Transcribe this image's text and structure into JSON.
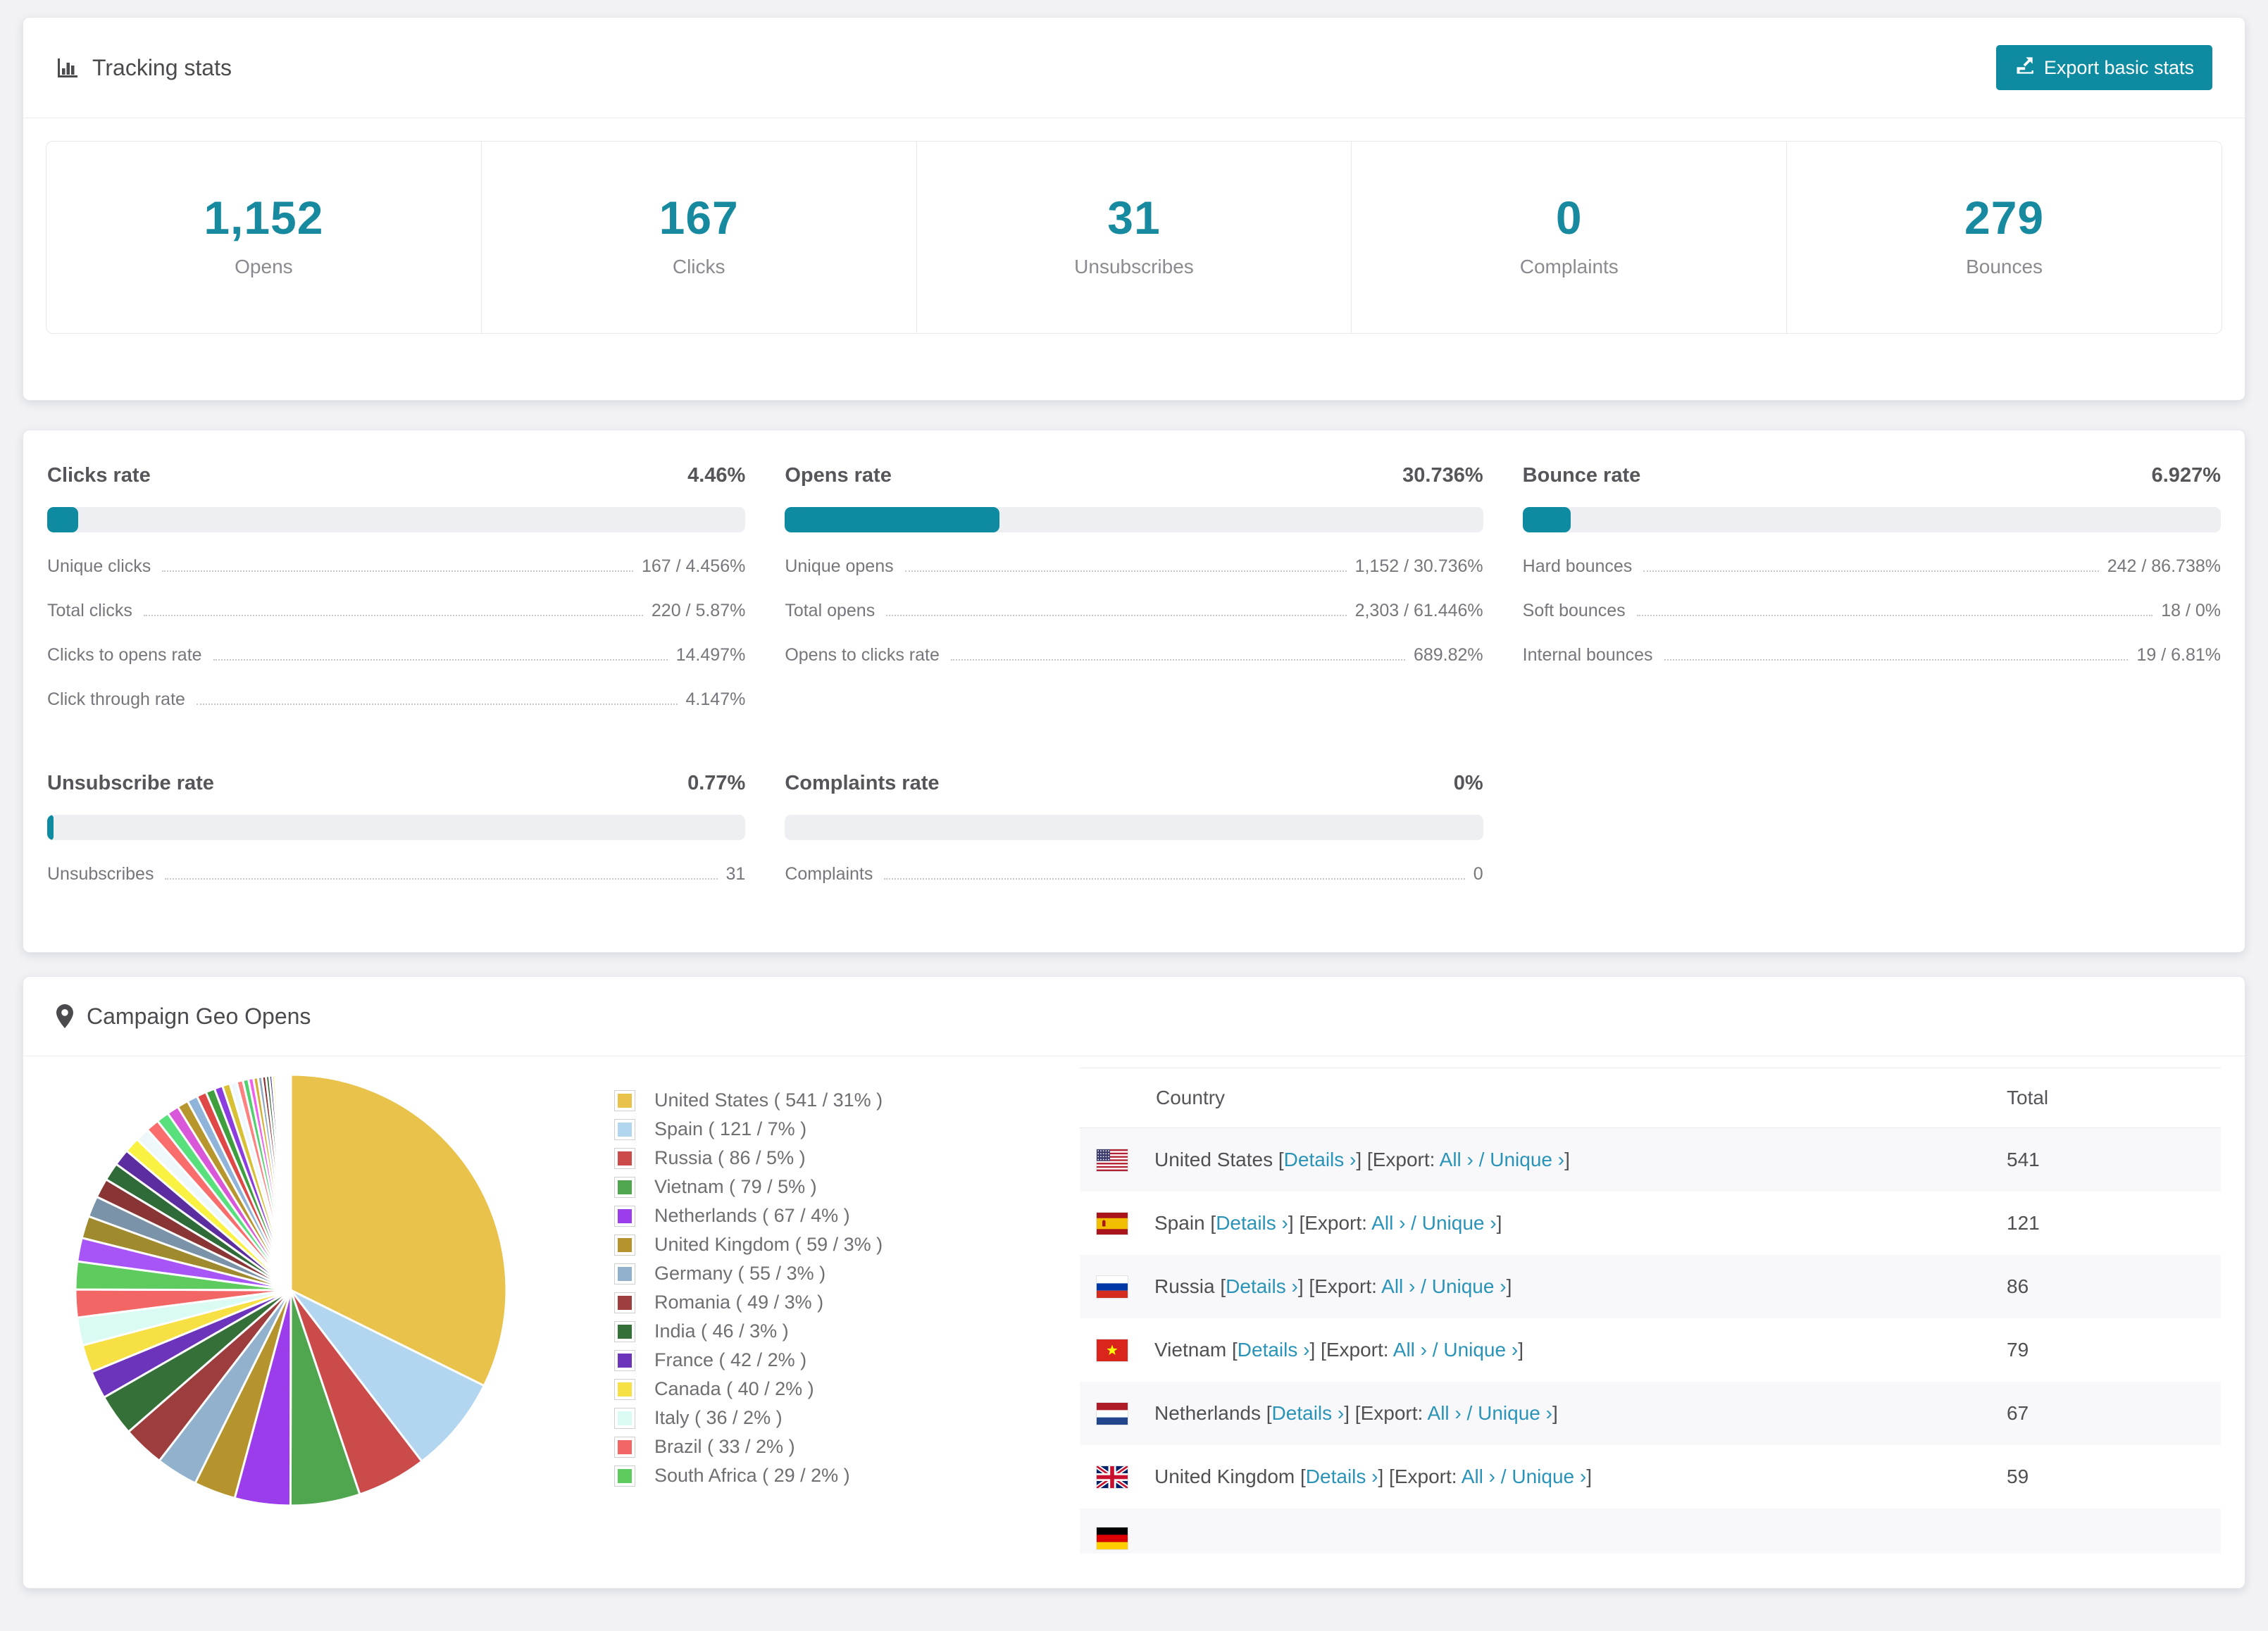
{
  "accent": "#0e8ba1",
  "link_color": "#2a93b8",
  "tracking": {
    "title": "Tracking stats",
    "export_button": "Export basic stats",
    "stats": [
      {
        "value": "1,152",
        "label": "Opens"
      },
      {
        "value": "167",
        "label": "Clicks"
      },
      {
        "value": "31",
        "label": "Unsubscribes"
      },
      {
        "value": "0",
        "label": "Complaints"
      },
      {
        "value": "279",
        "label": "Bounces"
      }
    ]
  },
  "rates": {
    "blocks": [
      {
        "name": "Clicks rate",
        "value": "4.46%",
        "percent": 4.46,
        "rows": [
          {
            "label": "Unique clicks",
            "value": "167 / 4.456%"
          },
          {
            "label": "Total clicks",
            "value": "220 / 5.87%"
          },
          {
            "label": "Clicks to opens rate",
            "value": "14.497%"
          },
          {
            "label": "Click through rate",
            "value": "4.147%"
          }
        ]
      },
      {
        "name": "Opens rate",
        "value": "30.736%",
        "percent": 30.736,
        "rows": [
          {
            "label": "Unique opens",
            "value": "1,152 / 30.736%"
          },
          {
            "label": "Total opens",
            "value": "2,303 / 61.446%"
          },
          {
            "label": "Opens to clicks rate",
            "value": "689.82%"
          }
        ]
      },
      {
        "name": "Bounce rate",
        "value": "6.927%",
        "percent": 6.927,
        "rows": [
          {
            "label": "Hard bounces",
            "value": "242 / 86.738%"
          },
          {
            "label": "Soft bounces",
            "value": "18 / 0%"
          },
          {
            "label": "Internal bounces",
            "value": "19 / 6.81%"
          }
        ]
      },
      {
        "name": "Unsubscribe rate",
        "value": "0.77%",
        "percent": 0.77,
        "rows": [
          {
            "label": "Unsubscribes",
            "value": "31"
          }
        ]
      },
      {
        "name": "Complaints rate",
        "value": "0%",
        "percent": 0,
        "rows": [
          {
            "label": "Complaints",
            "value": "0"
          }
        ]
      }
    ]
  },
  "geo": {
    "title": "Campaign Geo Opens",
    "table": {
      "headers": [
        "Country",
        "Total"
      ],
      "link_tokens": {
        "open_bracket": " [",
        "details": "Details ›",
        "export_mid": "] [Export: ",
        "all": "All ›",
        "slash": " / ",
        "unique": "Unique ›",
        "close_bracket": "]"
      },
      "rows": [
        {
          "country": "United States",
          "flag": "us",
          "total": "541"
        },
        {
          "country": "Spain",
          "flag": "es",
          "total": "121"
        },
        {
          "country": "Russia",
          "flag": "ru",
          "total": "86"
        },
        {
          "country": "Vietnam",
          "flag": "vn",
          "total": "79"
        },
        {
          "country": "Netherlands",
          "flag": "nl",
          "total": "67"
        },
        {
          "country": "United Kingdom",
          "flag": "gb",
          "total": "59"
        }
      ],
      "partial_row": {
        "flag": "de"
      }
    }
  },
  "chart_data": {
    "type": "pie",
    "title": "Campaign Geo Opens",
    "legend_position": "right",
    "start_angle_deg": -90,
    "direction": "clockwise",
    "slices": [
      {
        "label": "United States",
        "count": 541,
        "pct": 31,
        "color": "#e8c24a",
        "legend": "United States ( 541 / 31% )"
      },
      {
        "label": "Spain",
        "count": 121,
        "pct": 7,
        "color": "#b2d5f0",
        "legend": "Spain ( 121 / 7% )"
      },
      {
        "label": "Russia",
        "count": 86,
        "pct": 5,
        "color": "#cb4a4a",
        "legend": "Russia ( 86 / 5% )"
      },
      {
        "label": "Vietnam",
        "count": 79,
        "pct": 5,
        "color": "#4fa64f",
        "legend": "Vietnam ( 79 / 5% )"
      },
      {
        "label": "Netherlands",
        "count": 67,
        "pct": 4,
        "color": "#9b3deb",
        "legend": "Netherlands ( 67 / 4% )"
      },
      {
        "label": "United Kingdom",
        "count": 59,
        "pct": 3,
        "color": "#b5932d",
        "legend": "United Kingdom ( 59 / 3% )"
      },
      {
        "label": "Germany",
        "count": 55,
        "pct": 3,
        "color": "#92b1cc",
        "legend": "Germany ( 55 / 3% )"
      },
      {
        "label": "Romania",
        "count": 49,
        "pct": 3,
        "color": "#9e3d3d",
        "legend": "Romania ( 49 / 3% )"
      },
      {
        "label": "India",
        "count": 46,
        "pct": 3,
        "color": "#357038",
        "legend": "India ( 46 / 3% )"
      },
      {
        "label": "France",
        "count": 42,
        "pct": 2,
        "color": "#6c33bb",
        "legend": "France ( 42 / 2% )"
      },
      {
        "label": "Canada",
        "count": 40,
        "pct": 2,
        "color": "#f6e044",
        "legend": "Canada ( 40 / 2% )"
      },
      {
        "label": "Italy",
        "count": 36,
        "pct": 2,
        "color": "#d9fbf3",
        "legend": "Italy ( 36 / 2% )"
      },
      {
        "label": "Brazil",
        "count": 33,
        "pct": 2,
        "color": "#f26666",
        "legend": "Brazil ( 33 / 2% )"
      },
      {
        "label": "South Africa",
        "count": 29,
        "pct": 2,
        "color": "#5ecb5e",
        "legend": "South Africa ( 29 / 2% )"
      }
    ],
    "others_note": "remaining small unlabeled countries",
    "others_pct": [
      1.7,
      1.6,
      1.5,
      1.4,
      1.3,
      1.2,
      1.1,
      1.0,
      0.95,
      0.9,
      0.85,
      0.8,
      0.75,
      0.7,
      0.65,
      0.6,
      0.55,
      0.5,
      0.45,
      0.4,
      0.36,
      0.33,
      0.3,
      0.27,
      0.24,
      0.21,
      0.19,
      0.17,
      0.15,
      0.13,
      0.11,
      0.1,
      0.09,
      0.08,
      0.07,
      0.06,
      0.05,
      0.05,
      0.04,
      0.04
    ],
    "others_colors": [
      "#a855f7",
      "#a08a2e",
      "#7b93a8",
      "#8a3535",
      "#2f6b38",
      "#5b2d9e",
      "#f9f242",
      "#eef8fb",
      "#fa6d6d",
      "#58e07d",
      "#d957d9",
      "#b8962e",
      "#8fb3d9",
      "#e04848",
      "#3f9f3f",
      "#8c3de0",
      "#d8c035",
      "#f0f8ff",
      "#ff8080",
      "#52d070",
      "#f060f0",
      "#d4af37",
      "#90aac0",
      "#8a3030",
      "#2a5f30",
      "#3a2a8a",
      "#f0ea50",
      "#e8f8ff",
      "#ff9090",
      "#60d080",
      "#e070e0",
      "#c8a838",
      "#98b8d0",
      "#c04040",
      "#50a850",
      "#9850e8",
      "#e8d048",
      "#f8fcff",
      "#ff9898",
      "#68d888"
    ]
  }
}
